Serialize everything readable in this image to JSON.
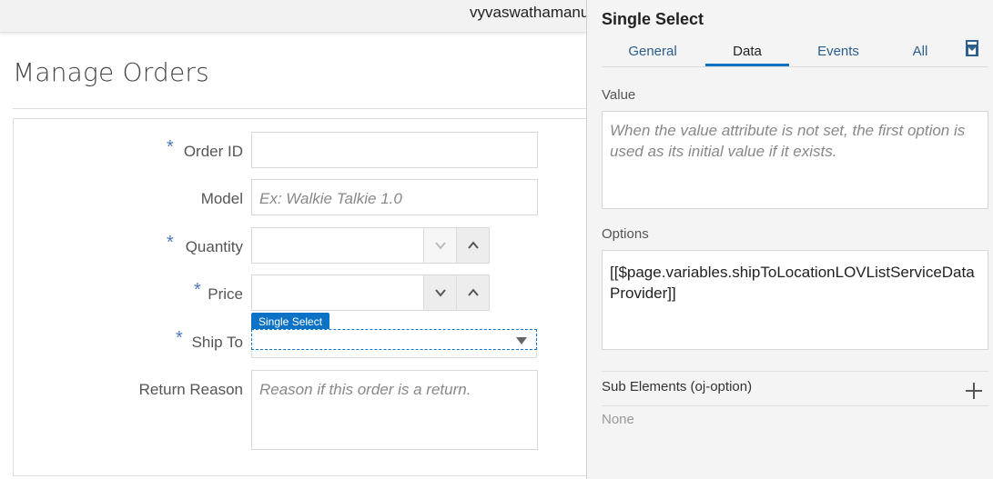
{
  "header": {
    "user_name": "vyvaswathamanu"
  },
  "page": {
    "title": "Manage Orders"
  },
  "form": {
    "order_id": {
      "label": "Order ID",
      "required_mark": "*",
      "value": ""
    },
    "model": {
      "label": "Model",
      "placeholder": "Ex: Walkie Talkie 1.0"
    },
    "quantity": {
      "label": "Quantity",
      "required_mark": "*",
      "value": ""
    },
    "price": {
      "label": "Price",
      "required_mark": "*",
      "value": ""
    },
    "ship_to": {
      "label": "Ship To",
      "required_mark": "*",
      "selection_badge": "Single Select"
    },
    "return_reason": {
      "label": "Return Reason",
      "placeholder": "Reason if this order is a return."
    }
  },
  "inspector": {
    "title": "Single Select",
    "tabs": [
      {
        "label": "General",
        "active": false
      },
      {
        "label": "Data",
        "active": true
      },
      {
        "label": "Events",
        "active": false
      },
      {
        "label": "All",
        "active": false
      }
    ],
    "value": {
      "label": "Value",
      "placeholder": "When the value attribute is not set, the first option is used as its initial value if it exists."
    },
    "options": {
      "label": "Options",
      "value": "[[$page.variables.shipToLocationLOVListServiceDataProvider]]"
    },
    "sub_elements": {
      "label": "Sub Elements (oj-option)",
      "empty_text": "None"
    }
  },
  "colors": {
    "accent": "#0c72c6",
    "link": "#2b5d8c",
    "required": "#4a7bb7"
  },
  "icons": [
    "chevron-down-icon",
    "chevron-up-icon",
    "caret-down-icon",
    "bookmark-icon",
    "add-icon"
  ]
}
